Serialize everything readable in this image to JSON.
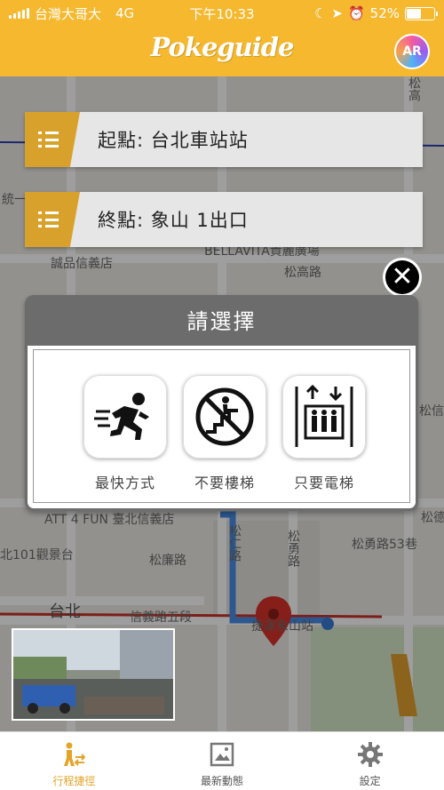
{
  "status_bar": {
    "carrier": "台灣大哥大",
    "network": "4G",
    "time": "下午10:33",
    "battery": "52%",
    "battery_level": 0.52
  },
  "header": {
    "logo": "Pokeguide",
    "ar_button": "AR"
  },
  "route": {
    "start": "起點: 台北車站站",
    "end": "終點: 象山 1出口"
  },
  "map_labels": {
    "eslite": "誠品信義店",
    "bellavita": "BELLAVITA貴麗廣場",
    "songgao": "松高路",
    "songlian": "松廉路",
    "songren": "松仁路",
    "songyong": "松勇路",
    "songyong53": "松勇路53巷",
    "att4fun": "ATT 4 FUN 臺北信義店",
    "observatory": "北101觀景台",
    "taipei": "台北",
    "xinyi5": "信義路五段",
    "xiangshan_station": "捷運象山站",
    "tong": "統一",
    "song_r1": "松信",
    "song_r2": "松仁",
    "song_r3": "松德",
    "song_top": "松高"
  },
  "modal": {
    "title": "請選擇",
    "options": [
      {
        "label": "最快方式",
        "icon": "running-person-icon"
      },
      {
        "label": "不要樓梯",
        "icon": "no-stairs-icon"
      },
      {
        "label": "只要電梯",
        "icon": "elevator-icon"
      }
    ]
  },
  "tabs": [
    {
      "label": "行程捷徑",
      "icon": "route-person-icon",
      "active": true
    },
    {
      "label": "最新動態",
      "icon": "news-image-icon",
      "active": false
    },
    {
      "label": "設定",
      "icon": "gear-icon",
      "active": false
    }
  ],
  "colors": {
    "brand": "#f5b82e",
    "route_blue": "#4a8fe7",
    "marker_red": "#d9312b",
    "modal_gray": "#6c6c6c"
  }
}
